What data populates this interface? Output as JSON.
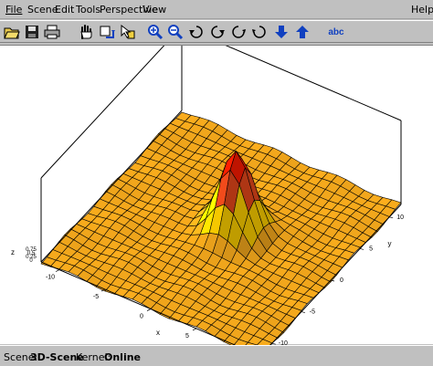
{
  "menu": {
    "file": "File",
    "scene": "Scene",
    "edit": "Edit",
    "tools": "Tools",
    "perspective": "Perspective",
    "view": "View",
    "help": "Help"
  },
  "toolbar": {
    "icons": [
      "open-folder-icon",
      "save-disk-icon",
      "print-icon",
      "hand-pan-icon",
      "rotate-scene-icon",
      "select-arrow-icon",
      "zoom-in-icon",
      "zoom-out-icon",
      "rotate-left-icon",
      "rotate-right-icon",
      "tilt-back-icon",
      "tilt-forward-icon",
      "move-down-icon",
      "move-up-icon",
      "text-label-icon"
    ],
    "label_button_text": "abc"
  },
  "plot": {
    "axis_z_label": "z",
    "axis_x_label": "x",
    "axis_y_label": "y",
    "z_ticks": [
      "0.75",
      "0.5",
      "0.25",
      "0"
    ],
    "x_ticks": [
      "-10",
      "-5",
      "0",
      "5",
      "10"
    ],
    "y_ticks": [
      "10",
      "5",
      "0",
      "-5",
      "-10"
    ],
    "colors": {
      "low": "#f4a81c",
      "mid": "#ffd000",
      "high": "#e8481a",
      "peak": "#ff1a00",
      "grid": "#000000",
      "box": "#000000"
    }
  },
  "status": {
    "scene_label": "Scene:",
    "scene_value": "3D-Scene",
    "kernel_label": "Kernel:",
    "kernel_value": "Online"
  }
}
